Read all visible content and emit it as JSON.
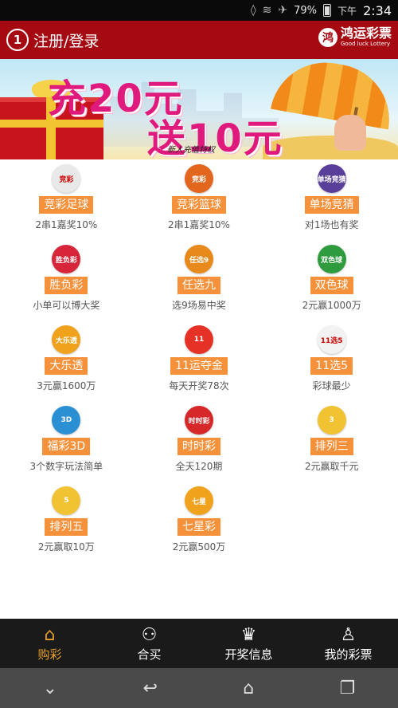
{
  "status_bar": {
    "battery": "79%",
    "ampm": "下午",
    "time": "2:34"
  },
  "header": {
    "title": "注册/登录",
    "brand_cn": "鸿运彩票",
    "brand_en": "Good luck Lottery"
  },
  "banner": {
    "line1": "充20元",
    "line2": "送10元",
    "tag": "新人充值特权"
  },
  "games": [
    {
      "name": "竞彩足球",
      "desc": "2串1嘉奖10%",
      "logo_color": "#e9e9e9",
      "logo_text": "竞彩"
    },
    {
      "name": "竞彩篮球",
      "desc": "2串1嘉奖10%",
      "logo_color": "#e2661d",
      "logo_text": "竞彩"
    },
    {
      "name": "单场竞猜",
      "desc": "对1场也有奖",
      "logo_color": "#5a3f9a",
      "logo_text": "单场竞猜"
    },
    {
      "name": "胜负彩",
      "desc": "小单可以博大奖",
      "logo_color": "#d7263a",
      "logo_text": "胜负彩"
    },
    {
      "name": "任选九",
      "desc": "选9场易中奖",
      "logo_color": "#e8891c",
      "logo_text": "任选9"
    },
    {
      "name": "双色球",
      "desc": "2元赢1000万",
      "logo_color": "#2f9b3f",
      "logo_text": "双色球"
    },
    {
      "name": "大乐透",
      "desc": "3元赢1600万",
      "logo_color": "#f0a21c",
      "logo_text": "大乐透"
    },
    {
      "name": "11运夺金",
      "desc": "每天开奖78次",
      "logo_color": "#e63127",
      "logo_text": "11"
    },
    {
      "name": "11选5",
      "desc": "彩球最少",
      "logo_color": "#f2f2f2",
      "logo_text": "11选5"
    },
    {
      "name": "福彩3D",
      "desc": "3个数字玩法简单",
      "logo_color": "#2b8fd3",
      "logo_text": "3D"
    },
    {
      "name": "时时彩",
      "desc": "全天120期",
      "logo_color": "#d62828",
      "logo_text": "时时彩"
    },
    {
      "name": "排列三",
      "desc": "2元赢取千元",
      "logo_color": "#f1c232",
      "logo_text": "3"
    },
    {
      "name": "排列五",
      "desc": "2元赢取10万",
      "logo_color": "#f1c232",
      "logo_text": "5"
    },
    {
      "name": "七星彩",
      "desc": "2元赢500万",
      "logo_color": "#f0a21c",
      "logo_text": "七星"
    }
  ],
  "tabbar": [
    {
      "label": "购彩",
      "icon": "home-icon",
      "glyph": "⌂",
      "active": true
    },
    {
      "label": "合买",
      "icon": "group-icon",
      "glyph": "⚇",
      "active": false
    },
    {
      "label": "开奖信息",
      "icon": "trophy-icon",
      "glyph": "♛",
      "active": false
    },
    {
      "label": "我的彩票",
      "icon": "user-icon",
      "glyph": "♙",
      "active": false
    }
  ],
  "navbar": [
    {
      "icon": "chevron-down-icon",
      "glyph": "⌄"
    },
    {
      "icon": "back-icon",
      "glyph": "↩"
    },
    {
      "icon": "home-icon",
      "glyph": "⌂"
    },
    {
      "icon": "recent-apps-icon",
      "glyph": "❐"
    }
  ]
}
